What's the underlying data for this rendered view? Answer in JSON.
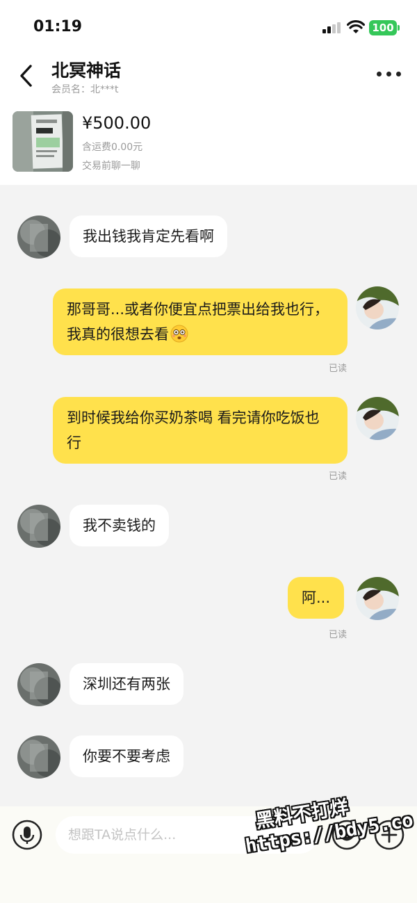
{
  "status_bar": {
    "time": "01:19",
    "battery": "100",
    "icons": [
      "signal-icon",
      "wifi-icon",
      "battery-icon"
    ]
  },
  "header": {
    "back_icon": "chevron-left-icon",
    "title": "北冥神话",
    "member": "会员名：北***t",
    "more_icon": "more-dots-icon"
  },
  "product": {
    "price": "¥500.00",
    "shipping": "含运费0.00元",
    "hint": "交易前聊一聊"
  },
  "messages": [
    {
      "side": "left",
      "text": "我出钱我肯定先看啊"
    },
    {
      "side": "right",
      "text": "那哥哥...或者你便宜点把票出给我也行，我真的很想去看",
      "emoji": "flushed-face-emoji",
      "status": "已读"
    },
    {
      "side": "right",
      "text": "到时候我给你买奶茶喝  看完请你吃饭也行",
      "status": "已读"
    },
    {
      "side": "left",
      "text": "我不卖钱的"
    },
    {
      "side": "right",
      "text": "阿...",
      "status": "已读"
    },
    {
      "side": "left",
      "text": "深圳还有两张"
    },
    {
      "side": "left",
      "text": "你要不要考虑"
    }
  ],
  "input_bar": {
    "placeholder": "想跟TA说点什么...",
    "value": "",
    "icons": [
      "microphone-icon",
      "emoji-icon",
      "plus-icon"
    ]
  },
  "watermark": {
    "line1": "黑料不打烊",
    "line2": "https://bdy5.co"
  },
  "colors": {
    "accent_bubble": "#ffe14c",
    "left_bubble": "#ffffff",
    "background": "#f3f3f3",
    "battery": "#35c759"
  }
}
